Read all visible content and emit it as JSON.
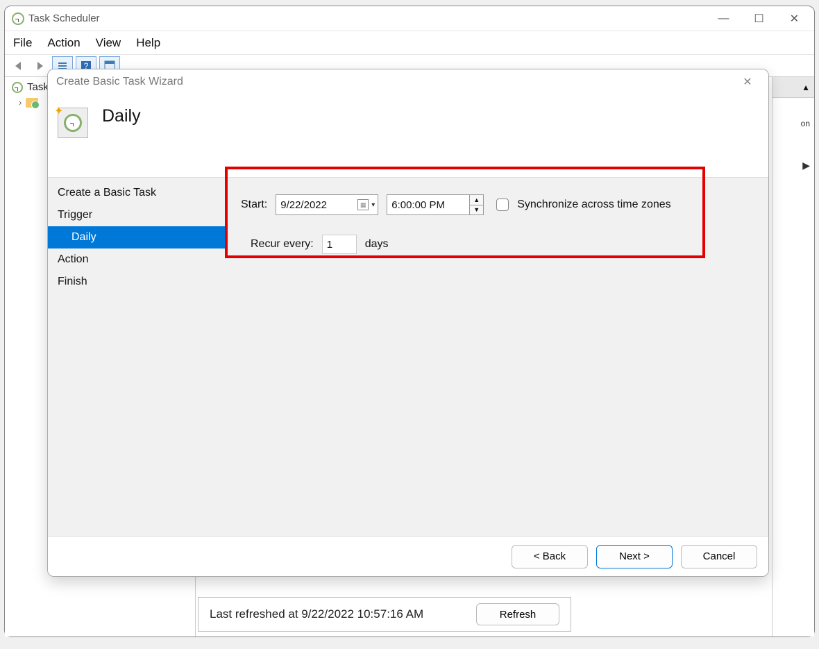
{
  "main_window": {
    "title": "Task Scheduler",
    "win_controls": {
      "min": "—",
      "max": "☐",
      "close": "✕"
    }
  },
  "menu": {
    "file": "File",
    "action": "Action",
    "view": "View",
    "help": "Help"
  },
  "tree": {
    "root_label": "Task…",
    "child_postfix": " "
  },
  "right_panel": {
    "fragment1": "on",
    "arrow": "▶"
  },
  "status": {
    "last_refreshed": "Last refreshed at 9/22/2022 10:57:16 AM",
    "refresh_label": "Refresh"
  },
  "wizard": {
    "title": "Create Basic Task Wizard",
    "heading": "Daily",
    "steps": {
      "create": "Create a Basic Task",
      "trigger": "Trigger",
      "daily": "Daily",
      "action": "Action",
      "finish": "Finish"
    },
    "form": {
      "start_label": "Start:",
      "date_value": "9/22/2022",
      "time_value": "6:00:00 PM",
      "sync_label": "Synchronize across time zones",
      "recur_label": "Recur every:",
      "recur_value": "1",
      "recur_unit": "days"
    },
    "buttons": {
      "back": "< Back",
      "next": "Next >",
      "cancel": "Cancel"
    }
  }
}
